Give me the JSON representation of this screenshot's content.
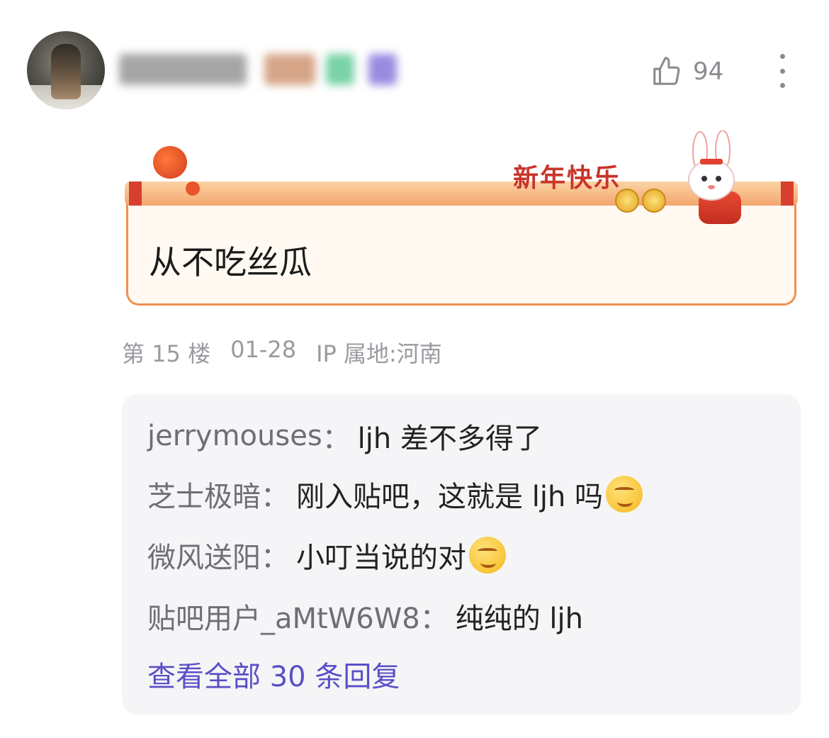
{
  "post": {
    "username": "",
    "like_count": "94",
    "content": "从不吃丝瓜",
    "decoration_text": "新年快乐",
    "floor": "第 15 楼",
    "date": "01-28",
    "ip_location": "IP 属地:河南"
  },
  "icons": {
    "like": "thumbs-up-icon",
    "more": "more-vertical-icon"
  },
  "replies": [
    {
      "author": "jerrymouses",
      "text": "ljh 差不多得了",
      "emoji": ""
    },
    {
      "author": "芝士极暗",
      "text": "刚入贴吧，这就是 ljh 吗",
      "emoji": "smirk-emoji"
    },
    {
      "author": "微风送阳",
      "text": "小叮当说的对",
      "emoji": "laugh-emoji"
    },
    {
      "author": "贴吧用户_aMtW6W8",
      "text": "纯纯的 ljh",
      "emoji": ""
    }
  ],
  "view_all": "查看全部 30 条回复",
  "colors": {
    "link": "#5b4fc6",
    "meta": "#9a9aa0",
    "card_border": "#f0904f"
  }
}
